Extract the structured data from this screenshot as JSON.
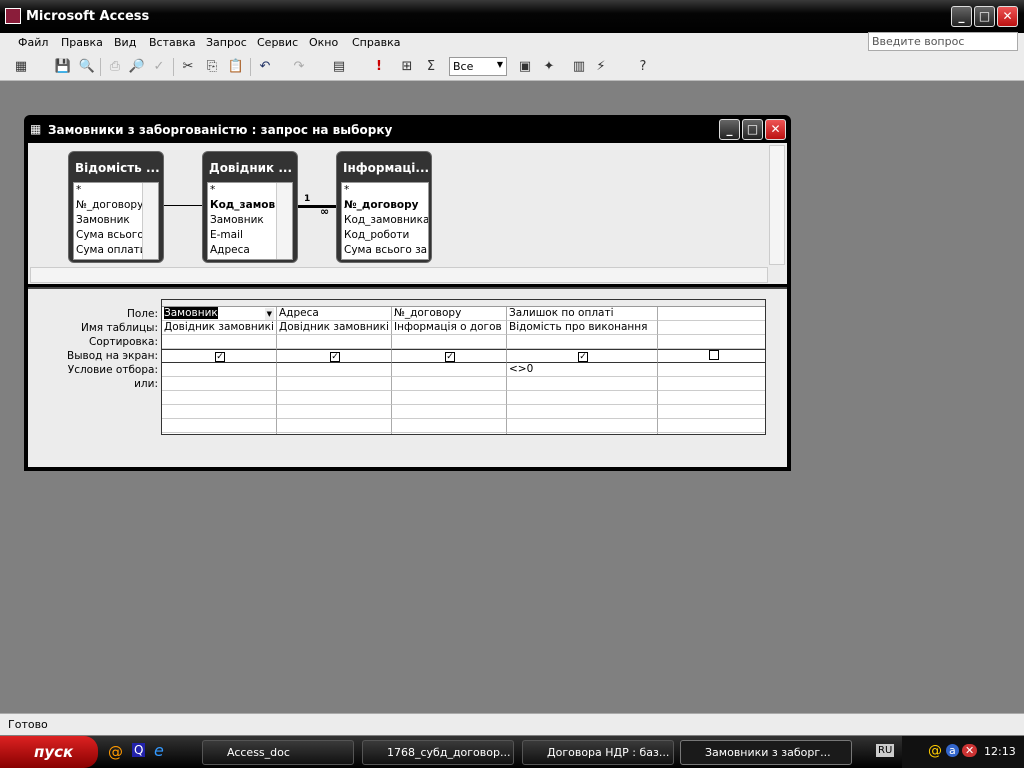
{
  "app": {
    "title": "Microsoft Access"
  },
  "menu": [
    "Файл",
    "Правка",
    "Вид",
    "Вставка",
    "Запрос",
    "Сервис",
    "Окно",
    "Справка"
  ],
  "ask_placeholder": "Введите вопрос",
  "toolbar": {
    "top_values": "Все"
  },
  "query_window": {
    "title": "Замовники з заборгованістю : запрос на выборку",
    "tables": [
      {
        "title": "Відомість ...",
        "fields": [
          "*",
          "№_договору",
          "Замовник",
          "Сума всього",
          "Сума оплати"
        ]
      },
      {
        "title": "Довідник ...",
        "fields": [
          "*",
          "Код_замовника",
          "Замовник",
          "E-mail",
          "Адреса"
        ]
      },
      {
        "title": "Інформаці...",
        "fields": [
          "*",
          "№_договору",
          "Код_замовника",
          "Код_роботи",
          "Сума всього за д"
        ]
      }
    ],
    "relation": {
      "one": "1",
      "many": "∞"
    },
    "row_labels": [
      "Поле:",
      "Имя таблицы:",
      "Сортировка:",
      "Вывод на экран:",
      "Условие отбора:",
      "или:"
    ],
    "columns": [
      {
        "field": "Замовник",
        "table": "Довідник замовникі",
        "show": true,
        "criteria": ""
      },
      {
        "field": "Адреса",
        "table": "Довідник замовникі",
        "show": true,
        "criteria": ""
      },
      {
        "field": "№_договору",
        "table": "Інформація о догов",
        "show": true,
        "criteria": ""
      },
      {
        "field": "Залишок по оплаті",
        "table": "Відомість про виконання",
        "show": true,
        "criteria": "<>0"
      },
      {
        "field": "",
        "table": "",
        "show": false,
        "criteria": ""
      }
    ]
  },
  "status": "Готово",
  "taskbar": {
    "start": "пуск",
    "tasks": [
      "Access_doc",
      "1768_субд_договор...",
      "Договора НДР : баз...",
      "Замовники з заборг..."
    ],
    "lang": "RU",
    "clock": "12:13"
  }
}
